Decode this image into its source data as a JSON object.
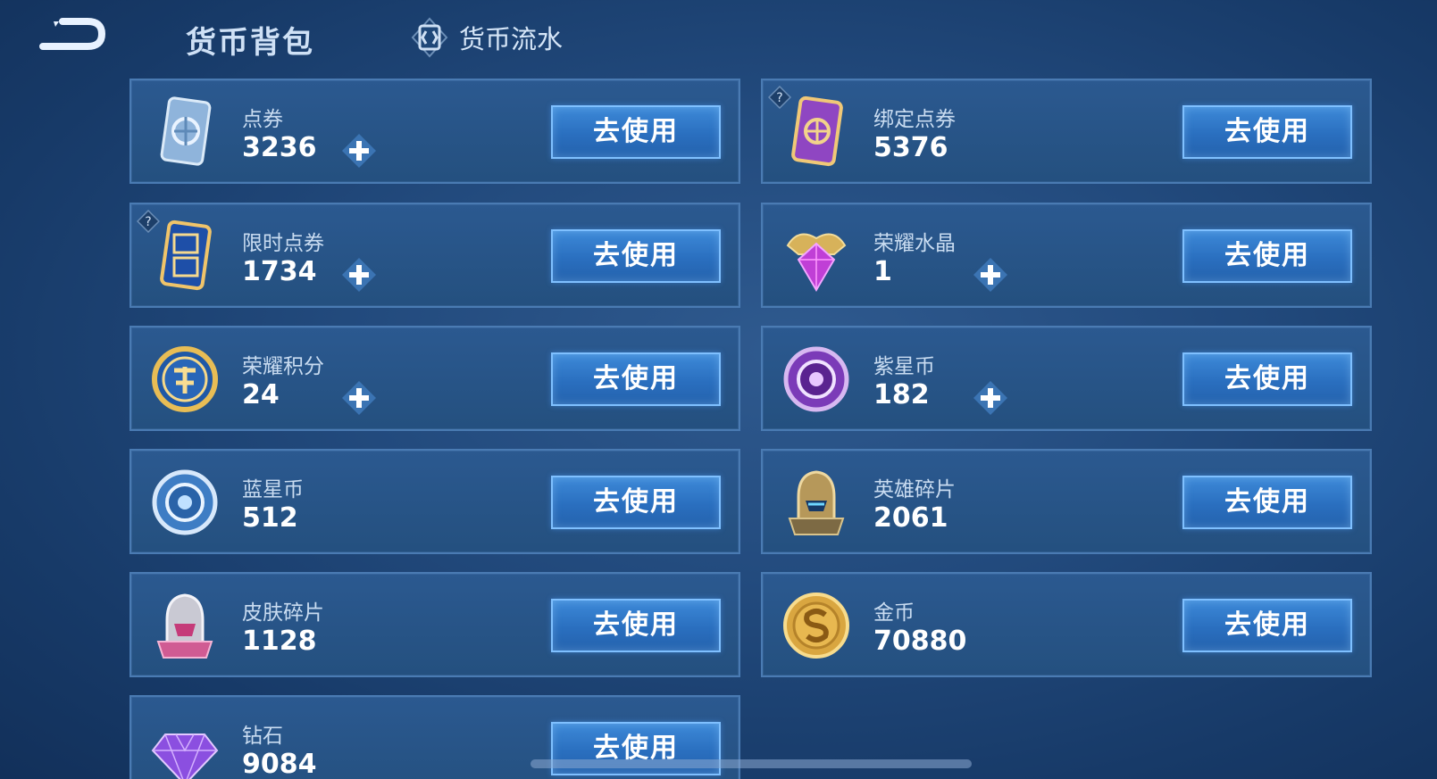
{
  "header": {
    "title": "货币背包",
    "ledger_tab": "货币流水"
  },
  "items": [
    {
      "name": "点券",
      "value": "3236",
      "button": "去使用",
      "icon": "coupon-card-icon",
      "plus": true,
      "help": false
    },
    {
      "name": "绑定点券",
      "value": "5376",
      "button": "去使用",
      "icon": "bound-coupon-card-icon",
      "plus": false,
      "help": true
    },
    {
      "name": "限时点券",
      "value": "1734",
      "button": "去使用",
      "icon": "limited-coupon-icon",
      "plus": true,
      "help": true
    },
    {
      "name": "荣耀水晶",
      "value": "1",
      "button": "去使用",
      "icon": "glory-crystal-icon",
      "plus": true,
      "help": false
    },
    {
      "name": "荣耀积分",
      "value": "24",
      "button": "去使用",
      "icon": "glory-points-coin-icon",
      "plus": true,
      "help": false
    },
    {
      "name": "紫星币",
      "value": "182",
      "button": "去使用",
      "icon": "purple-star-coin-icon",
      "plus": true,
      "help": false
    },
    {
      "name": "蓝星币",
      "value": "512",
      "button": "去使用",
      "icon": "blue-star-coin-icon",
      "plus": false,
      "help": false
    },
    {
      "name": "英雄碎片",
      "value": "2061",
      "button": "去使用",
      "icon": "hero-fragment-helmet-icon",
      "plus": false,
      "help": false
    },
    {
      "name": "皮肤碎片",
      "value": "1128",
      "button": "去使用",
      "icon": "skin-fragment-helmet-icon",
      "plus": false,
      "help": false
    },
    {
      "name": "金币",
      "value": "70880",
      "button": "去使用",
      "icon": "gold-coin-icon",
      "plus": false,
      "help": false
    },
    {
      "name": "钻石",
      "value": "9084",
      "button": "去使用",
      "icon": "diamond-gem-icon",
      "plus": false,
      "help": false
    }
  ],
  "colors": {
    "card_bg": "#2b5990",
    "card_border": "#4a7bb3",
    "button_bg": "#2a6fbf",
    "button_border": "#7fc0ff"
  }
}
